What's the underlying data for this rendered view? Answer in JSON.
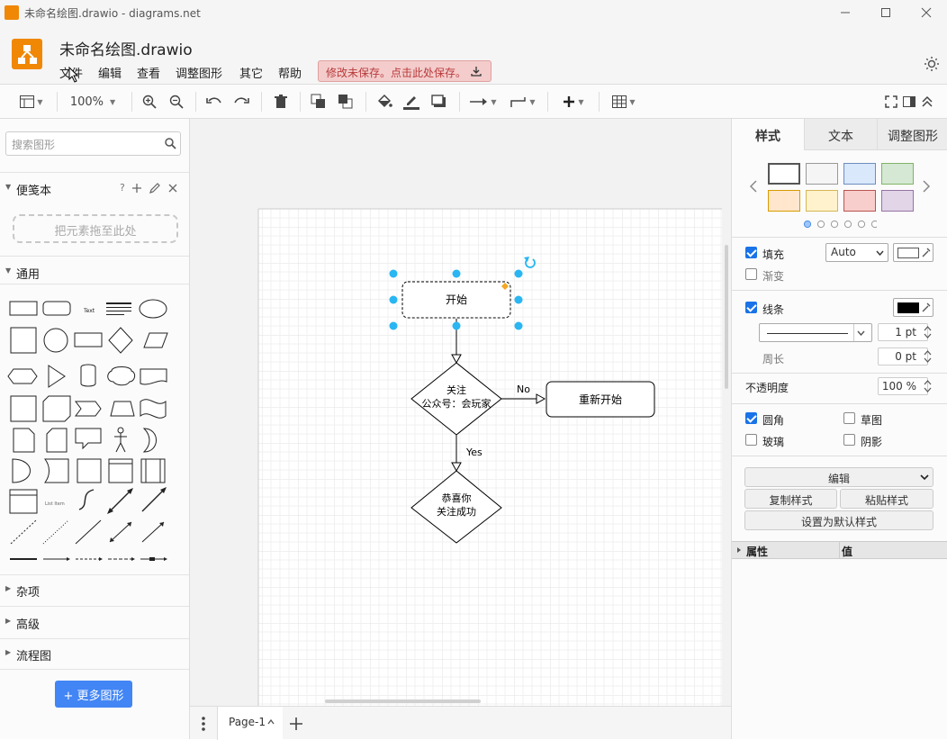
{
  "window": {
    "title": "未命名绘图.drawio - diagrams.net"
  },
  "header": {
    "doc_title": "未命名绘图.drawio",
    "menus": [
      "文件",
      "编辑",
      "查看",
      "调整图形",
      "其它",
      "帮助"
    ],
    "unsaved_notice": "修改未保存。点击此处保存。"
  },
  "toolbar": {
    "zoom": "100%"
  },
  "sidebar": {
    "search_placeholder": "搜索图形",
    "scratchpad": {
      "title": "便笺本",
      "help": "?",
      "drop_hint": "把元素拖至此处"
    },
    "general": {
      "title": "通用"
    },
    "sections": [
      "杂项",
      "高级",
      "流程图"
    ],
    "more_shapes": "更多图形"
  },
  "canvas": {
    "nodes": {
      "start": "开始",
      "decision": [
        "关注",
        "公众号：会玩家"
      ],
      "restart": "重新开始",
      "success": [
        "恭喜你",
        "关注成功"
      ]
    },
    "edge_labels": {
      "no": "No",
      "yes": "Yes"
    }
  },
  "bottombar": {
    "page": "Page-1"
  },
  "format_panel": {
    "tabs": [
      "样式",
      "文本",
      "调整图形"
    ],
    "swatch_colors": [
      "#ffffff",
      "#f5f5f5",
      "#dae8fc",
      "#d5e8d4",
      "#ffe6cc",
      "#fff2cc",
      "#f8cecc",
      "#e1d5e7"
    ],
    "fill_label": "填充",
    "fill_mode": "Auto",
    "gradient_label": "渐变",
    "line_label": "线条",
    "line_width": "1 pt",
    "perimeter_label": "周长",
    "perimeter_value": "0 pt",
    "opacity_label": "不透明度",
    "opacity_value": "100 %",
    "rounded_label": "圆角",
    "sketch_label": "草图",
    "glass_label": "玻璃",
    "shadow_label": "阴影",
    "edit_button": "编辑",
    "copy_style": "复制样式",
    "paste_style": "粘贴样式",
    "set_default": "设置为默认样式",
    "property_header": "属性",
    "value_header": "值"
  },
  "colors": {
    "accent": "#f08705",
    "selection": "#29b6f2",
    "unsaved_bg": "#f4cccc",
    "more_shapes_bg": "#4285f4"
  }
}
